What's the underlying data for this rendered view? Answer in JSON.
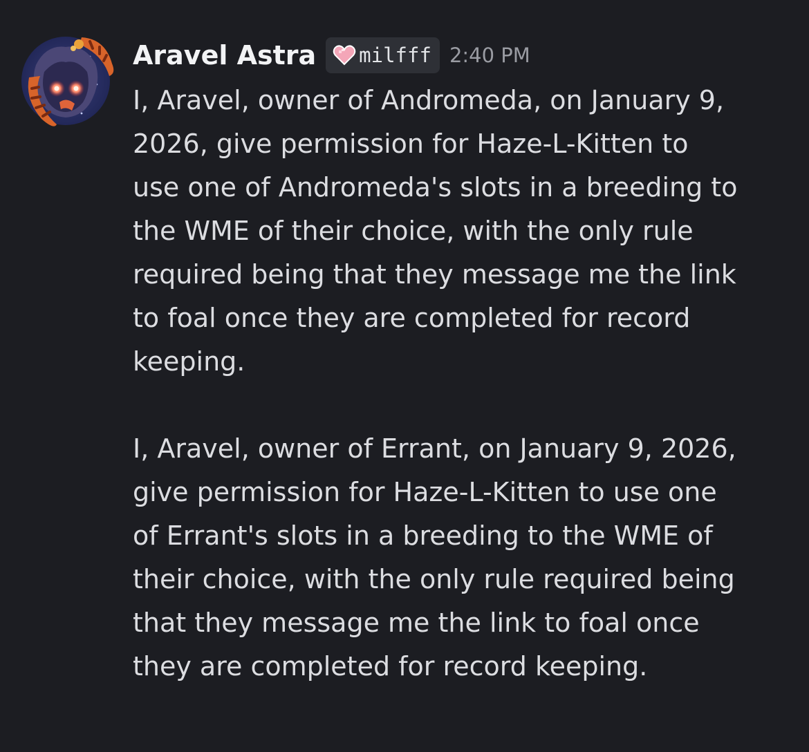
{
  "message": {
    "author": "Aravel Astra",
    "tag": {
      "icon": "pink-heart-icon",
      "label": "milfff"
    },
    "timestamp": "2:40 PM",
    "paragraphs": [
      {
        "lines": [
          "I, Aravel, owner of Andromeda, on January 9,",
          "2026, give permission for Haze-L-Kitten to",
          "use one of Andromeda's slots in a breeding to",
          "the WME of their choice, with the only rule",
          "required being that they message me the link",
          "to foal once they are completed for record",
          "keeping."
        ]
      },
      {
        "lines": [
          "I, Aravel, owner of Errant, on January 9, 2026,",
          "give permission for Haze-L-Kitten to use one",
          "of Errant's slots in a breeding to the WME of",
          "their choice, with the only rule required being",
          "that they message me the link to foal once",
          "they are completed for record keeping."
        ]
      }
    ]
  },
  "colors": {
    "background": "#1c1d22",
    "username": "#f2f3f5",
    "body_text": "#dcdde1",
    "timestamp": "#9a9ca3",
    "tag_background": "#2e3036",
    "heart": "#f4a6b8"
  }
}
